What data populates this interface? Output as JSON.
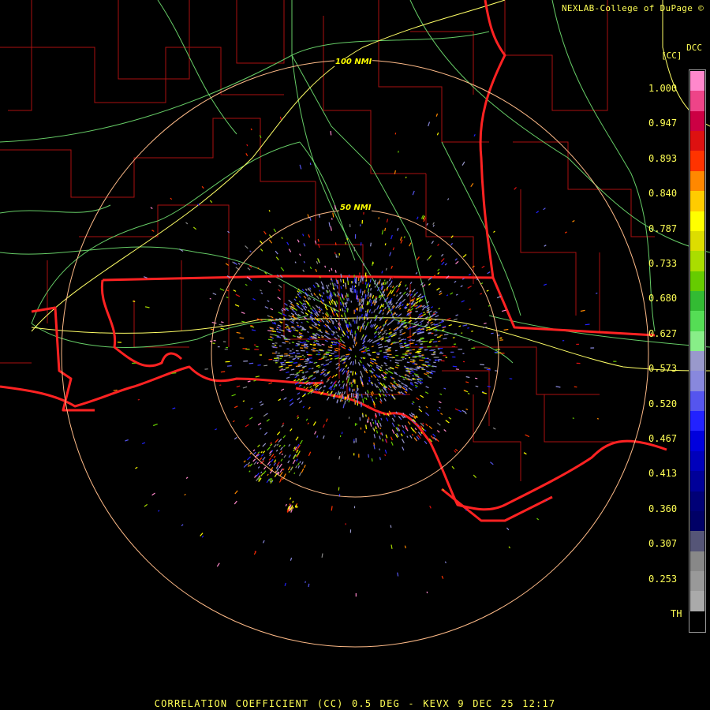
{
  "header": {
    "credit": "NEXLAB-College of DuPage ©",
    "station_code": "DCC"
  },
  "legend": {
    "unit": "[CC]",
    "labels": [
      "1.000",
      "0.947",
      "0.893",
      "0.840",
      "0.787",
      "0.733",
      "0.680",
      "0.627",
      "0.573",
      "0.520",
      "0.467",
      "0.413",
      "0.360",
      "0.307",
      "0.253",
      "TH"
    ],
    "colors": [
      "#ff88cc",
      "#ee4488",
      "#cc0044",
      "#dd1111",
      "#ff3300",
      "#ff8800",
      "#ffcc00",
      "#ffff00",
      "#dddd00",
      "#aadd00",
      "#66cc00",
      "#33bb33",
      "#55dd55",
      "#88ee88",
      "#9999cc",
      "#8888dd",
      "#5555ee",
      "#2222ff",
      "#0000dd",
      "#0000bb",
      "#000099",
      "#000077",
      "#000066",
      "#555577",
      "#888888",
      "#999999",
      "#aaaaaa",
      "#000000"
    ]
  },
  "range_rings": {
    "inner_label": "50 NMI",
    "outer_label": "100 NMI"
  },
  "caption": "CORRELATION COEFFICIENT (CC) 0.5 DEG - KEVX 9 DEC 25 12:17",
  "colors": {
    "state_line": "#ff2222",
    "county_line": "#aa1111",
    "road": "#66cc66",
    "interstate": "#ffff66",
    "ring": "#ffbb88",
    "text": "#ffff55"
  }
}
